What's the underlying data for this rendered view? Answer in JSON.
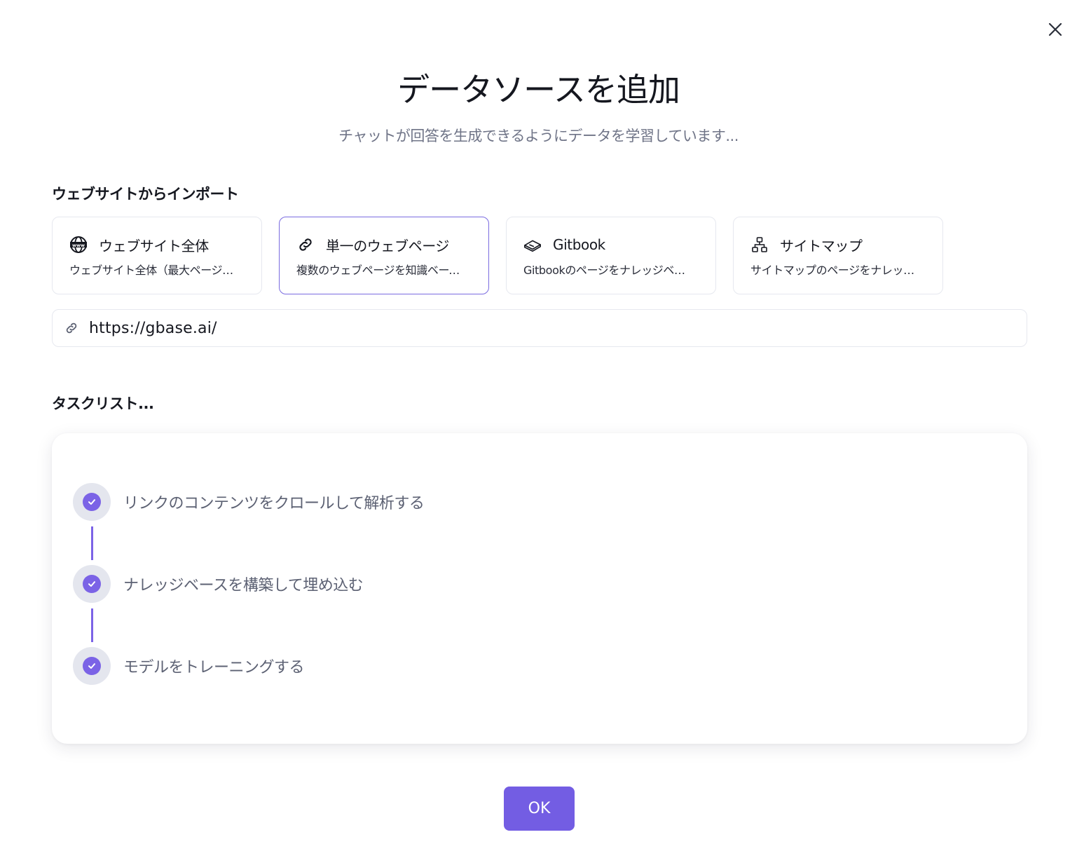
{
  "dialog": {
    "title": "データソースを追加",
    "subtitle": "チャットが回答を生成できるようにデータを学習しています..."
  },
  "import": {
    "heading": "ウェブサイトからインポート",
    "options": [
      {
        "icon": "globe-www-icon",
        "title": "ウェブサイト全体",
        "description": "ウェブサイト全体（最大ページ数...",
        "selected": false
      },
      {
        "icon": "link-icon",
        "title": "単一のウェブページ",
        "description": "複数のウェブページを知識ベースに...",
        "selected": true
      },
      {
        "icon": "book-icon",
        "title": "Gitbook",
        "description": "Gitbookのページをナレッジベース...",
        "selected": false
      },
      {
        "icon": "sitemap-icon",
        "title": "サイトマップ",
        "description": "サイトマップのページをナレッジベー...",
        "selected": false
      }
    ],
    "url": {
      "value": "https://gbase.ai/",
      "icon": "link-icon"
    }
  },
  "tasks": {
    "heading": "タスクリスト...",
    "items": [
      {
        "label": "リンクのコンテンツをクロールして解析する",
        "status": "done"
      },
      {
        "label": "ナレッジベースを構築して埋め込む",
        "status": "done"
      },
      {
        "label": "モデルをトレーニングする",
        "status": "done"
      }
    ]
  },
  "actions": {
    "ok_label": "OK"
  },
  "colors": {
    "accent": "#735de3",
    "check": "#7b63e6",
    "selected_border": "#7a6be0"
  }
}
